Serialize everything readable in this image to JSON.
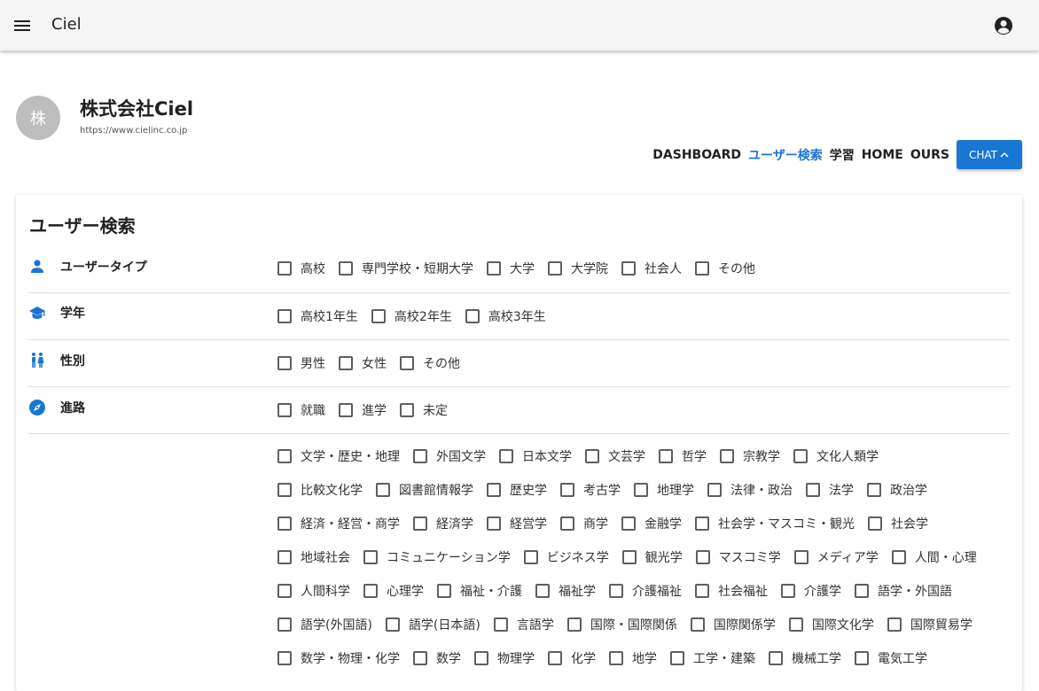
{
  "appbar": {
    "title": "Ciel",
    "menu_icon": "menu-icon",
    "account_icon": "account-circle-icon"
  },
  "company": {
    "avatar_char": "株",
    "name": "株式会社Ciel",
    "url": "https://www.cielinc.co.jp"
  },
  "nav": {
    "items": [
      "DASHBOARD",
      "ユーザー検索",
      "学習",
      "HOME",
      "OURS"
    ],
    "active": "ユーザー検索",
    "chat_label": "CHAT",
    "chat_icon": "chevron-up-icon"
  },
  "search": {
    "title": "ユーザー検索",
    "rows": [
      {
        "label": "ユーザータイプ",
        "icon": "person-icon",
        "options": [
          "高校",
          "専門学校・短期大学",
          "大学",
          "大学院",
          "社会人",
          "その他"
        ]
      },
      {
        "label": "学年",
        "icon": "school-icon",
        "options": [
          "高校1年生",
          "高校2年生",
          "高校3年生"
        ]
      },
      {
        "label": "性別",
        "icon": "wc-icon",
        "options": [
          "男性",
          "女性",
          "その他"
        ]
      },
      {
        "label": "進路",
        "icon": "compass-icon",
        "options": [
          "就職",
          "進学",
          "未定"
        ]
      }
    ],
    "field_lines": [
      [
        "文学・歴史・地理",
        "外国文学",
        "日本文学",
        "文芸学",
        "哲学",
        "宗教学",
        "文化人類学"
      ],
      [
        "比較文化学",
        "図書館情報学",
        "歴史学",
        "考古学",
        "地理学",
        "法律・政治",
        "法学",
        "政治学"
      ],
      [
        "経済・経営・商学",
        "経済学",
        "経営学",
        "商学",
        "金融学",
        "社会学・マスコミ・観光",
        "社会学"
      ],
      [
        "地域社会",
        "コミュニケーション学",
        "ビジネス学",
        "観光学",
        "マスコミ学",
        "メディア学",
        "人間・心理"
      ],
      [
        "人間科学",
        "心理学",
        "福祉・介護",
        "福祉学",
        "介護福祉",
        "社会福祉",
        "介護学",
        "語学・外国語"
      ],
      [
        "語学(外国語)",
        "語学(日本語)",
        "言語学",
        "国際・国際関係",
        "国際関係学",
        "国際文化学",
        "国際貿易学"
      ],
      [
        "数学・物理・化学",
        "数学",
        "物理学",
        "化学",
        "地学",
        "工学・建築",
        "機械工学",
        "電気工学"
      ]
    ]
  },
  "colors": {
    "accent": "#1976d2",
    "appbar_bg": "#f5f5f5",
    "avatar_bg": "#bdbdbd"
  }
}
